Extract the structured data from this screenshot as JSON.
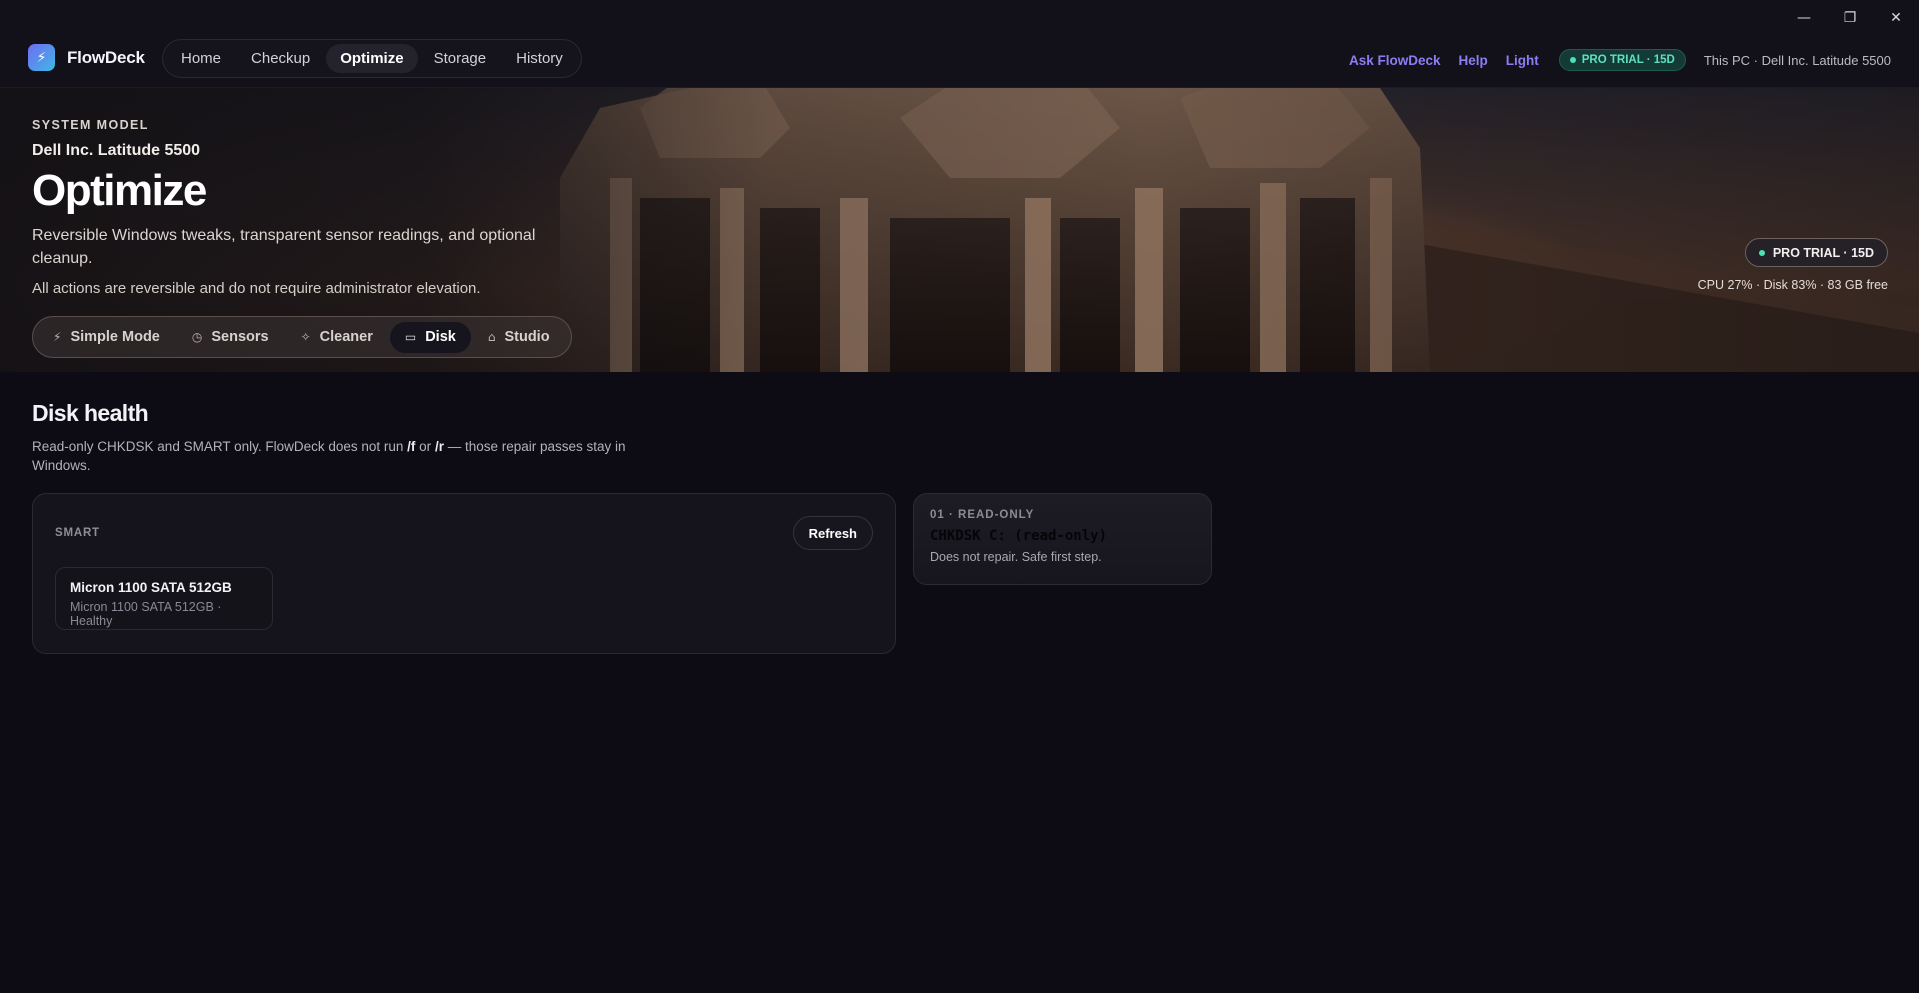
{
  "window": {
    "minimize": "—",
    "maximize": "❐",
    "close": "✕"
  },
  "brand": {
    "name": "FlowDeck",
    "logo_glyph": "⚡"
  },
  "nav": {
    "items": [
      {
        "label": "Home"
      },
      {
        "label": "Checkup"
      },
      {
        "label": "Optimize",
        "active": true
      },
      {
        "label": "Storage"
      },
      {
        "label": "History"
      }
    ]
  },
  "header_right": {
    "ask": "Ask FlowDeck",
    "help": "Help",
    "theme": "Light",
    "trial": "PRO TRIAL · 15D",
    "pc_info": "This PC · Dell Inc. Latitude 5500"
  },
  "hero": {
    "eyebrow": "SYSTEM MODEL",
    "model": "Dell Inc. Latitude 5500",
    "title": "Optimize",
    "description": "Reversible Windows tweaks, transparent sensor readings, and optional cleanup.",
    "note": "All actions are reversible and do not require administrator elevation.",
    "badge": "PRO TRIAL · 15D",
    "stats": "CPU 27% · Disk 83% · 83 GB free",
    "tabs": [
      {
        "label": "Simple Mode",
        "icon": "⚡"
      },
      {
        "label": "Sensors",
        "icon": "◷"
      },
      {
        "label": "Cleaner",
        "icon": "✧"
      },
      {
        "label": "Disk",
        "icon": "▭",
        "active": true
      },
      {
        "label": "Studio",
        "icon": "⌂"
      }
    ]
  },
  "disk": {
    "title": "Disk health",
    "desc_prefix": "Read-only CHKDSK and SMART only. FlowDeck does not run ",
    "flag_f": "/f",
    "desc_or": " or ",
    "flag_r": "/r",
    "desc_suffix": " — those repair passes stay in Windows.",
    "smart": {
      "label": "SMART",
      "refresh": "Refresh",
      "drives": [
        {
          "name": "Micron 1100 SATA 512GB",
          "sub": "Micron 1100 SATA 512GB · Healthy"
        }
      ]
    },
    "chkdsk": {
      "eyebrow": "01 · READ-ONLY",
      "title": "CHKDSK C: (read-only)",
      "desc": "Does not repair. Safe first step."
    }
  },
  "colors": {
    "accent": "#8c7df6",
    "trial_green": "#5ee0bf",
    "background": "#0d0c14"
  }
}
